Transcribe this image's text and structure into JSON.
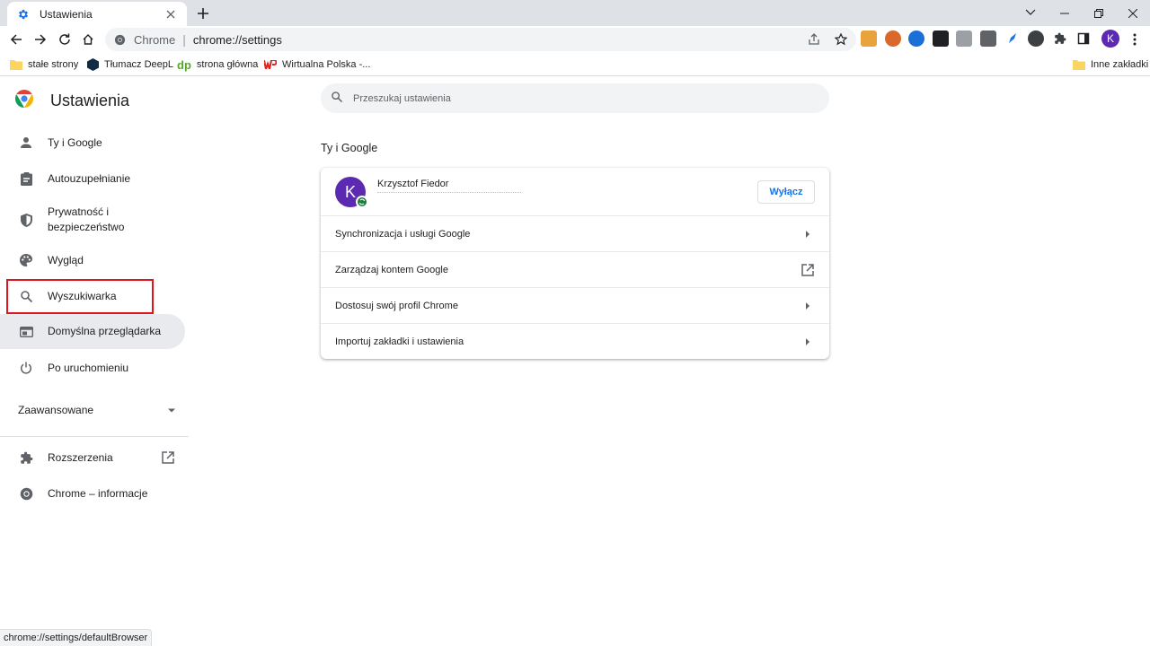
{
  "tab": {
    "title": "Ustawienia"
  },
  "omnibox": {
    "chip": "Chrome",
    "separator": "|",
    "url": "chrome://settings"
  },
  "profile_button": {
    "initial": "K"
  },
  "bookmarks": [
    {
      "label": "stałe strony"
    },
    {
      "label": "Tłumacz DeepL"
    },
    {
      "label": "strona główna",
      "icon_text": "dp"
    },
    {
      "label": "Wirtualna Polska -..."
    }
  ],
  "other_bookmarks": {
    "label": "Inne zakładki"
  },
  "settings": {
    "title": "Ustawienia",
    "search_placeholder": "Przeszukaj ustawienia"
  },
  "sidebar": {
    "items": [
      {
        "label": "Ty i Google",
        "icon": "person-icon"
      },
      {
        "label": "Autouzupełnianie",
        "icon": "clipboard-icon"
      },
      {
        "label": "Prywatność i bezpieczeństwo",
        "icon": "shield-icon"
      },
      {
        "label": "Wygląd",
        "icon": "palette-icon"
      },
      {
        "label": "Wyszukiwarka",
        "icon": "search-icon"
      },
      {
        "label": "Domyślna przeglądarka",
        "icon": "browser-icon"
      },
      {
        "label": "Po uruchomieniu",
        "icon": "power-icon"
      }
    ],
    "advanced": "Zaawansowane",
    "extensions": "Rozszerzenia",
    "about": "Chrome – informacje"
  },
  "main": {
    "section_title": "Ty i Google",
    "profile": {
      "name": "Krzysztof Fiedor",
      "initial": "K",
      "button": "Wyłącz"
    },
    "rows": [
      {
        "label": "Synchronizacja i usługi Google"
      },
      {
        "label": "Zarządzaj kontem Google"
      },
      {
        "label": "Dostosuj swój profil Chrome"
      },
      {
        "label": "Importuj zakładki i ustawienia"
      }
    ]
  },
  "statusbar": {
    "url": "chrome://settings/defaultBrowser"
  },
  "colors": {
    "accent": "#1a73e8",
    "avatar": "#5c2ab0",
    "highlight": "#e0161f",
    "active_bg": "#e8eaed"
  }
}
